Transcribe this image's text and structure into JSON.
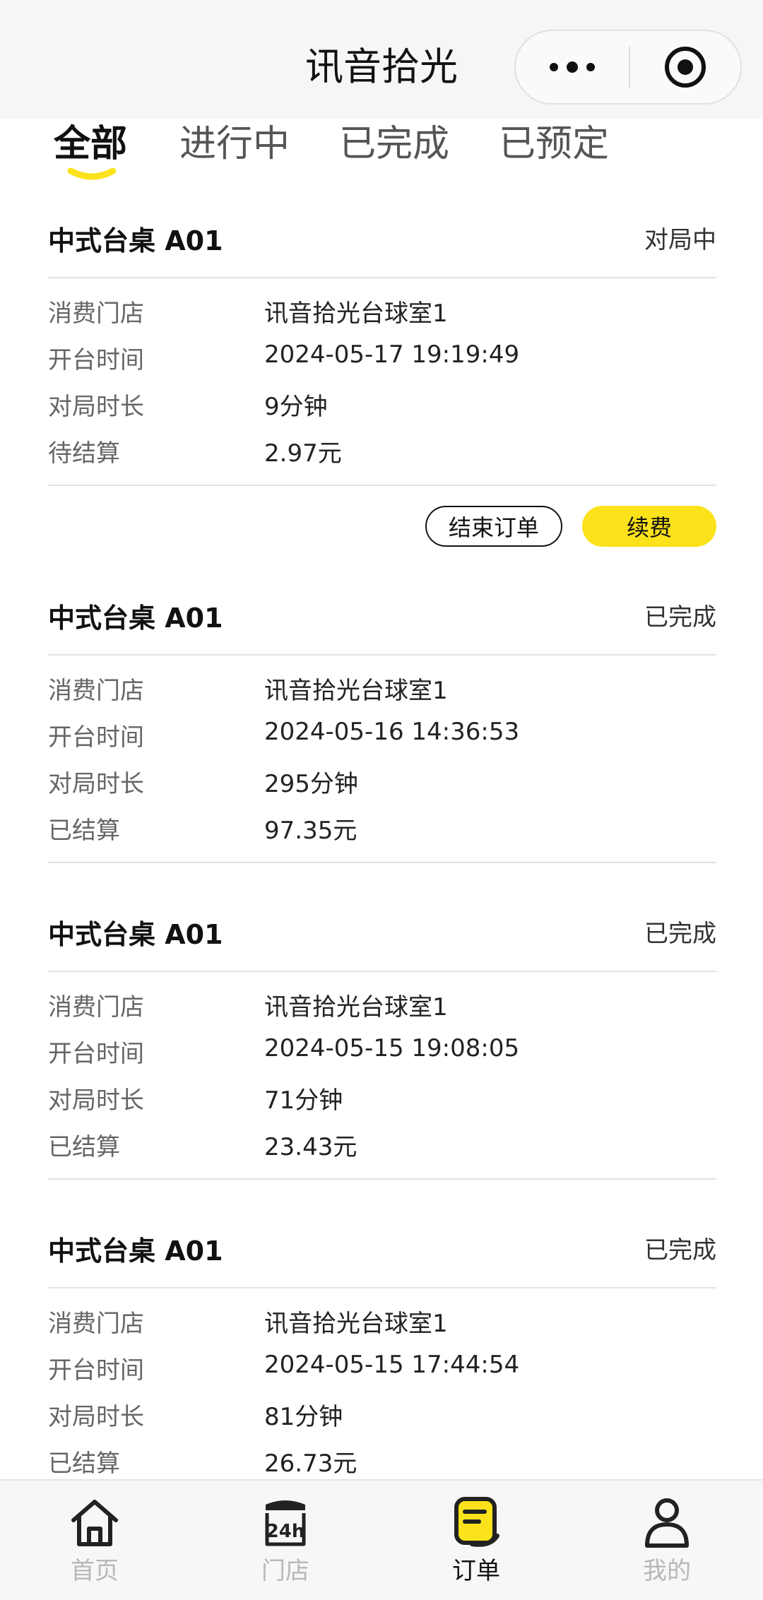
{
  "header": {
    "title": "讯音拾光"
  },
  "tabs": [
    {
      "label": "全部",
      "active": true
    },
    {
      "label": "进行中",
      "active": false
    },
    {
      "label": "已完成",
      "active": false
    },
    {
      "label": "已预定",
      "active": false
    }
  ],
  "orders": [
    {
      "title": "中式台桌 A01",
      "status": "对局中",
      "rows": [
        {
          "k": "消费门店",
          "v": "讯音拾光台球室1"
        },
        {
          "k": "开台时间",
          "v": "2024-05-17 19:19:49"
        },
        {
          "k": "对局时长",
          "v": "9分钟"
        },
        {
          "k": "待结算",
          "v": "2.97元"
        }
      ],
      "actions": {
        "end": "结束订单",
        "renew": "续费"
      }
    },
    {
      "title": "中式台桌 A01",
      "status": "已完成",
      "rows": [
        {
          "k": "消费门店",
          "v": "讯音拾光台球室1"
        },
        {
          "k": "开台时间",
          "v": "2024-05-16 14:36:53"
        },
        {
          "k": "对局时长",
          "v": "295分钟"
        },
        {
          "k": "已结算",
          "v": "97.35元"
        }
      ]
    },
    {
      "title": "中式台桌 A01",
      "status": "已完成",
      "rows": [
        {
          "k": "消费门店",
          "v": "讯音拾光台球室1"
        },
        {
          "k": "开台时间",
          "v": "2024-05-15 19:08:05"
        },
        {
          "k": "对局时长",
          "v": "71分钟"
        },
        {
          "k": "已结算",
          "v": "23.43元"
        }
      ]
    },
    {
      "title": "中式台桌 A01",
      "status": "已完成",
      "rows": [
        {
          "k": "消费门店",
          "v": "讯音拾光台球室1"
        },
        {
          "k": "开台时间",
          "v": "2024-05-15 17:44:54"
        },
        {
          "k": "对局时长",
          "v": "81分钟"
        },
        {
          "k": "已结算",
          "v": "26.73元"
        }
      ]
    }
  ],
  "bottom_nav": [
    {
      "label": "首页",
      "icon": "home-icon"
    },
    {
      "label": "门店",
      "icon": "store-24h-icon"
    },
    {
      "label": "订单",
      "icon": "order-icon",
      "active": true
    },
    {
      "label": "我的",
      "icon": "profile-icon"
    }
  ],
  "colors": {
    "accent": "#fbe21a",
    "active_text": "#111111",
    "inactive_text": "#b8b8b8"
  }
}
